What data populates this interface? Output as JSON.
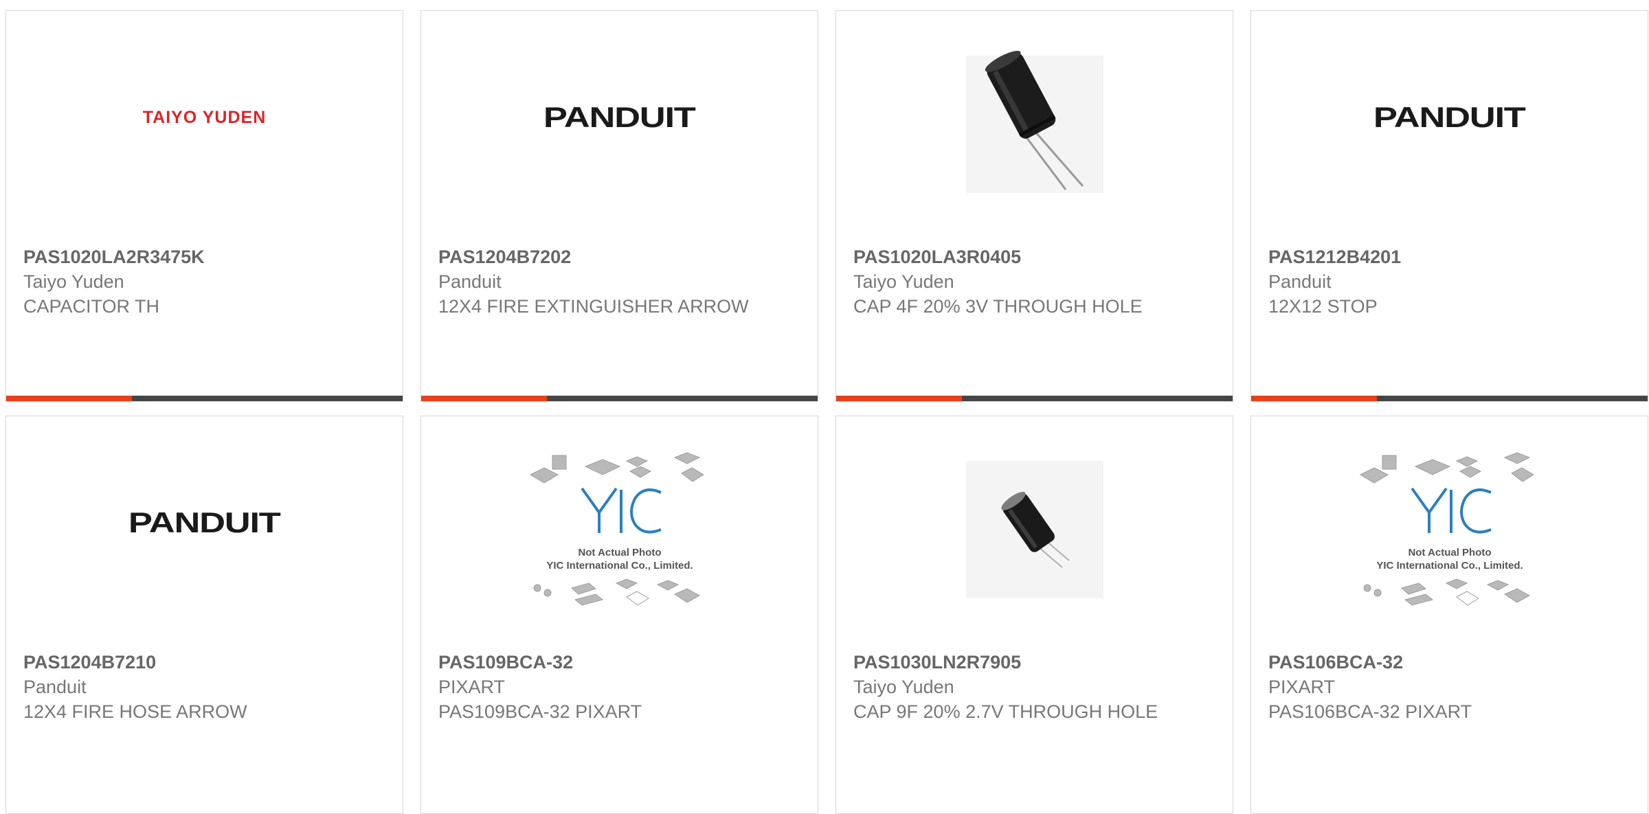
{
  "products": [
    {
      "part": "PAS1020LA2R3475K",
      "manufacturer": "Taiyo Yuden",
      "description": "CAPACITOR TH",
      "image": "taiyo-yuden-logo",
      "logo_text": "TAIYO YUDEN"
    },
    {
      "part": "PAS1204B7202",
      "manufacturer": "Panduit",
      "description": "12X4 FIRE EXTINGUISHER ARROW",
      "image": "panduit-logo",
      "logo_text": "PANDUIT"
    },
    {
      "part": "PAS1020LA3R0405",
      "manufacturer": "Taiyo Yuden",
      "description": "CAP 4F 20% 3V THROUGH HOLE",
      "image": "capacitor-photo"
    },
    {
      "part": "PAS1212B4201",
      "manufacturer": "Panduit",
      "description": "12X12 STOP",
      "image": "panduit-logo",
      "logo_text": "PANDUIT"
    },
    {
      "part": "PAS1204B7210",
      "manufacturer": "Panduit",
      "description": "12X4 FIRE HOSE ARROW",
      "image": "panduit-logo",
      "logo_text": "PANDUIT"
    },
    {
      "part": "PAS109BCA-32",
      "manufacturer": "PIXART",
      "description": "PAS109BCA-32 PIXART",
      "image": "yic-placeholder",
      "placeholder_line1": "Not Actual Photo",
      "placeholder_line2": "YIC International Co., Limited."
    },
    {
      "part": "PAS1030LN2R7905",
      "manufacturer": "Taiyo Yuden",
      "description": "CAP 9F 20% 2.7V THROUGH HOLE",
      "image": "capacitor-photo"
    },
    {
      "part": "PAS106BCA-32",
      "manufacturer": "PIXART",
      "description": "PAS106BCA-32 PIXART",
      "image": "yic-placeholder",
      "placeholder_line1": "Not Actual Photo",
      "placeholder_line2": "YIC International Co., Limited."
    }
  ],
  "colors": {
    "accent": "#e8401c",
    "bar": "#454545",
    "text_bold": "#666666",
    "text": "#777777",
    "taiyo_red": "#d9252a",
    "yic_blue": "#2a7fc4"
  }
}
